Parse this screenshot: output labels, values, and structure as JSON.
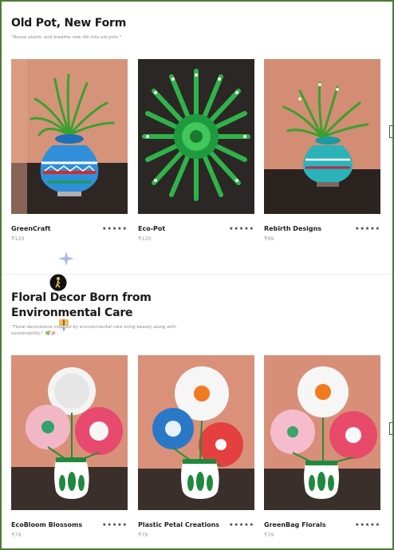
{
  "sections": [
    {
      "title": "Old Pot, New Form",
      "subtitle": "\"Reuse plastic and breathe new life into old pots.\"",
      "products": [
        {
          "name": "GreenCraft",
          "rating": "★★★★★",
          "price": "₹120",
          "image": "green leaves in painted blue pot"
        },
        {
          "name": "Eco-Pot",
          "rating": "★★★★★",
          "price": "₹120",
          "image": "green plastic bottle sunburst flower"
        },
        {
          "name": "Rebirth Designs",
          "rating": "★★★★★",
          "price": "₹99",
          "image": "green leaves in teal painted pot"
        }
      ]
    },
    {
      "title": "Floral Decor Born from Environmental Care",
      "subtitle": "\"Floral decorations inspired by environmental care bring beauty along with sustainability.\" 🌿🌸",
      "products": [
        {
          "name": "EcoBloom Blossoms",
          "rating": "★★★★★",
          "price": "₹79",
          "image": "white pink flowers in green pot"
        },
        {
          "name": "Plastic Petal Creations",
          "rating": "★★★★★",
          "price": "₹79",
          "image": "white blue red flowers in green pot"
        },
        {
          "name": "GreenBag Florals",
          "rating": "★★★★★",
          "price": "₹79",
          "image": "white pink flowers in green pot"
        }
      ]
    }
  ],
  "colors": {
    "frame_border": "#4f7a35",
    "image_bg_warm": "#d9907a",
    "image_bg_dark": "#2b2622"
  }
}
